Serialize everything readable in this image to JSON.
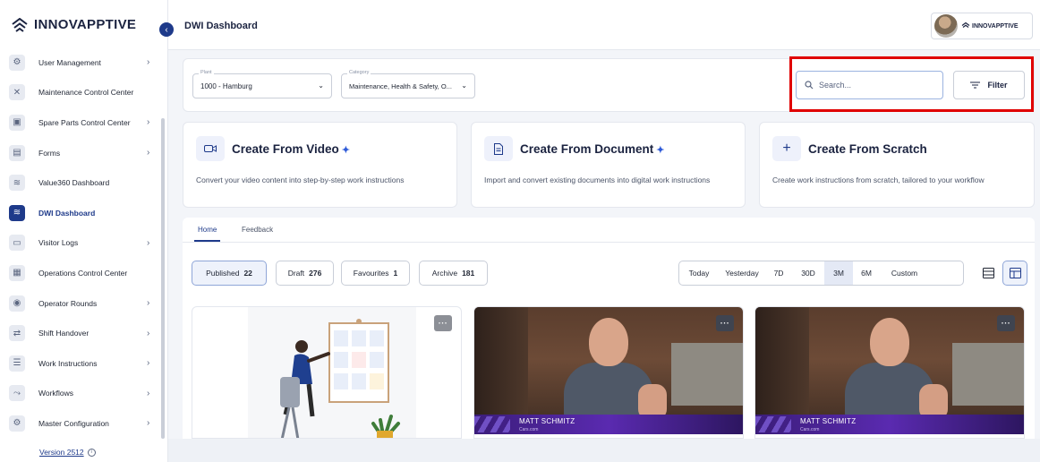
{
  "app": {
    "logo_text": "INNOVAPPTIVE",
    "accent": "#1e3a8a",
    "highlight_color": "#e00000"
  },
  "sidebar": {
    "items": [
      {
        "label": "User Management",
        "icon": "users-gear-icon",
        "chevron": true
      },
      {
        "label": "Maintenance Control Center",
        "icon": "tools-icon",
        "chevron": false
      },
      {
        "label": "Spare Parts Control Center",
        "icon": "forklift-icon",
        "chevron": true
      },
      {
        "label": "Forms",
        "icon": "form-icon",
        "chevron": true
      },
      {
        "label": "Value360 Dashboard",
        "icon": "dashboard-icon",
        "chevron": false
      },
      {
        "label": "DWI Dashboard",
        "icon": "dwi-dashboard-icon",
        "chevron": false,
        "active": true
      },
      {
        "label": "Visitor Logs",
        "icon": "visitor-log-icon",
        "chevron": true
      },
      {
        "label": "Operations Control Center",
        "icon": "operations-icon",
        "chevron": false
      },
      {
        "label": "Operator Rounds",
        "icon": "operator-rounds-icon",
        "chevron": true
      },
      {
        "label": "Shift Handover",
        "icon": "shift-handover-icon",
        "chevron": true
      },
      {
        "label": "Work Instructions",
        "icon": "list-icon",
        "chevron": true
      },
      {
        "label": "Workflows",
        "icon": "workflow-icon",
        "chevron": true
      },
      {
        "label": "Master Configuration",
        "icon": "gear-icon",
        "chevron": true
      }
    ],
    "version": "Version 2512"
  },
  "header": {
    "title": "DWI Dashboard",
    "brand": "INNOVAPPTIVE"
  },
  "filters": {
    "plant": {
      "label": "Plant",
      "value": "1000 - Hamburg"
    },
    "category": {
      "label": "Category",
      "value": "Maintenance, Health & Safety, O..."
    },
    "search_placeholder": "Search...",
    "filter_label": "Filter"
  },
  "create_cards": [
    {
      "title": "Create From Video",
      "sparkle": "✦",
      "description": "Convert your video content into step-by-step work instructions",
      "icon": "video-icon"
    },
    {
      "title": "Create From Document",
      "sparkle": "✦",
      "description": "Import and convert existing documents into digital work instructions",
      "icon": "document-icon"
    },
    {
      "title": "Create From Scratch",
      "sparkle": "",
      "description": "Create work instructions from scratch, tailored to your workflow",
      "icon": "plus-icon"
    }
  ],
  "tabs": [
    {
      "label": "Home",
      "active": true
    },
    {
      "label": "Feedback",
      "active": false
    }
  ],
  "status_chips": [
    {
      "label": "Published",
      "count": "22",
      "active": true
    },
    {
      "label": "Draft",
      "count": "276",
      "active": false
    },
    {
      "label": "Favourites",
      "count": "1",
      "active": false
    },
    {
      "label": "Archive",
      "count": "181",
      "active": false
    }
  ],
  "date_ranges": [
    {
      "label": "Today",
      "active": false
    },
    {
      "label": "Yesterday",
      "active": false
    },
    {
      "label": "7D",
      "active": false
    },
    {
      "label": "30D",
      "active": false
    },
    {
      "label": "3M",
      "active": true
    },
    {
      "label": "6M",
      "active": false
    },
    {
      "label": "Custom",
      "active": false
    }
  ],
  "cards": [
    {
      "type": "illustration",
      "more": "···"
    },
    {
      "type": "video",
      "more": "···",
      "presenter": "MATT SCHMITZ",
      "caption": "Cars.com"
    },
    {
      "type": "video",
      "more": "···",
      "presenter": "MATT SCHMITZ",
      "caption": "Cars.com"
    }
  ]
}
